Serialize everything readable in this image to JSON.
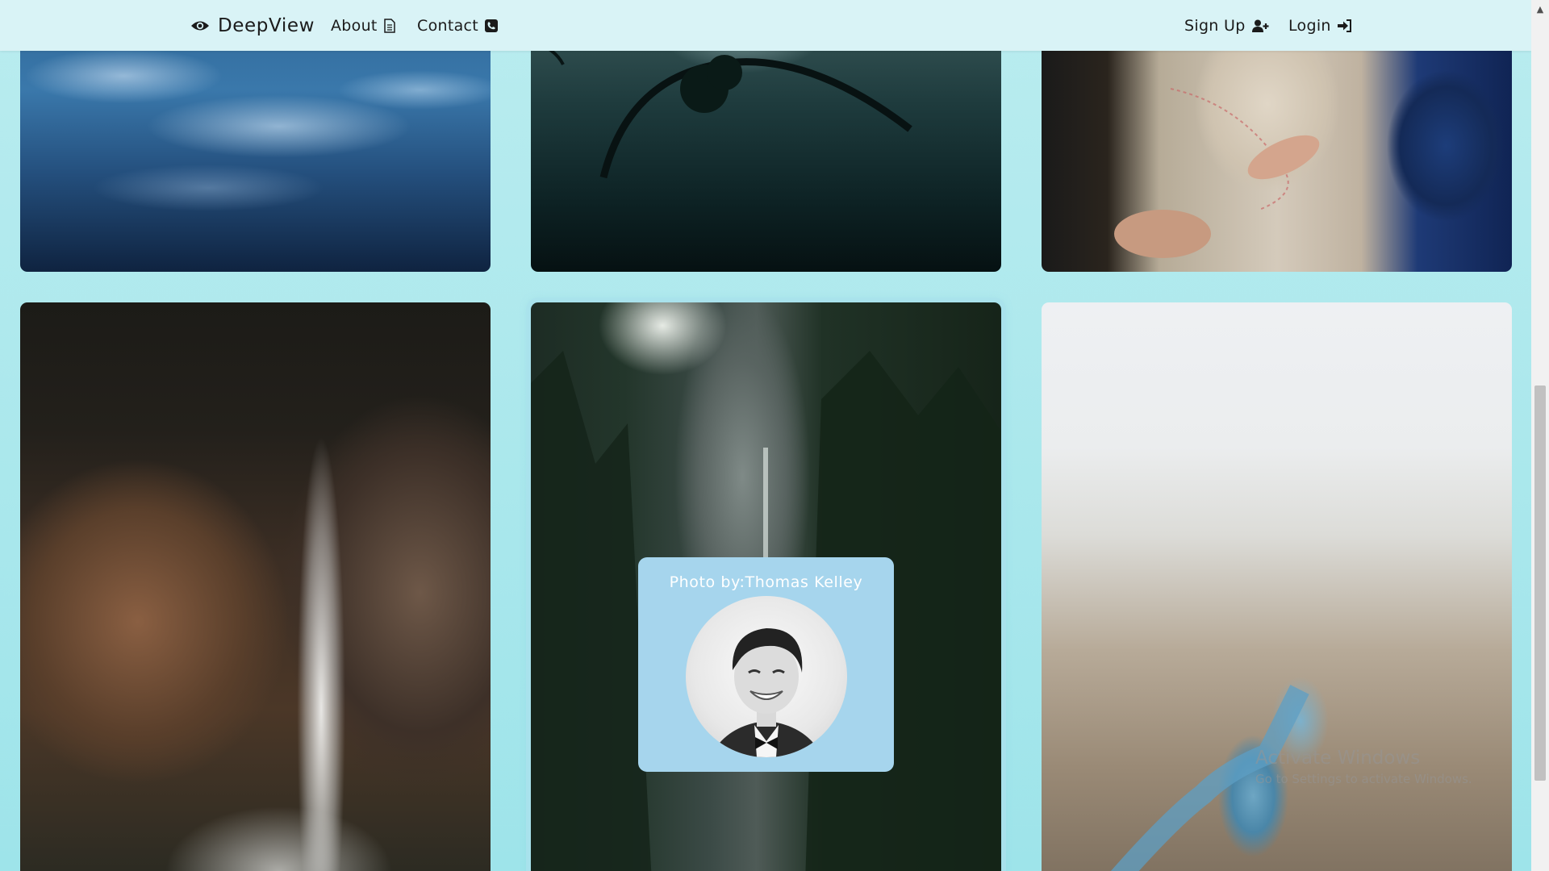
{
  "nav": {
    "brand": "DeepView",
    "about": "About",
    "contact": "Contact",
    "signup": "Sign Up",
    "login": "Login",
    "icons": {
      "brand": "eye-icon",
      "about": "document-icon",
      "contact": "phone-icon",
      "signup": "user-plus-icon",
      "login": "sign-in-icon"
    }
  },
  "gallery": {
    "photos": [
      {
        "subject": "ocean-waves"
      },
      {
        "subject": "misty-forest"
      },
      {
        "subject": "hands-on-map"
      },
      {
        "subject": "waterfall-cliff"
      },
      {
        "subject": "forest-cliff"
      },
      {
        "subject": "canyon-river"
      }
    ],
    "overlay": {
      "caption": "Photo by:Thomas Kelley"
    }
  },
  "watermark": {
    "title": "Activate Windows",
    "subtitle": "Go to Settings to activate Windows."
  },
  "colors": {
    "background": "#a8e6ec",
    "navbar": "#d9f3f6",
    "overlay": "#a6d5ed"
  }
}
